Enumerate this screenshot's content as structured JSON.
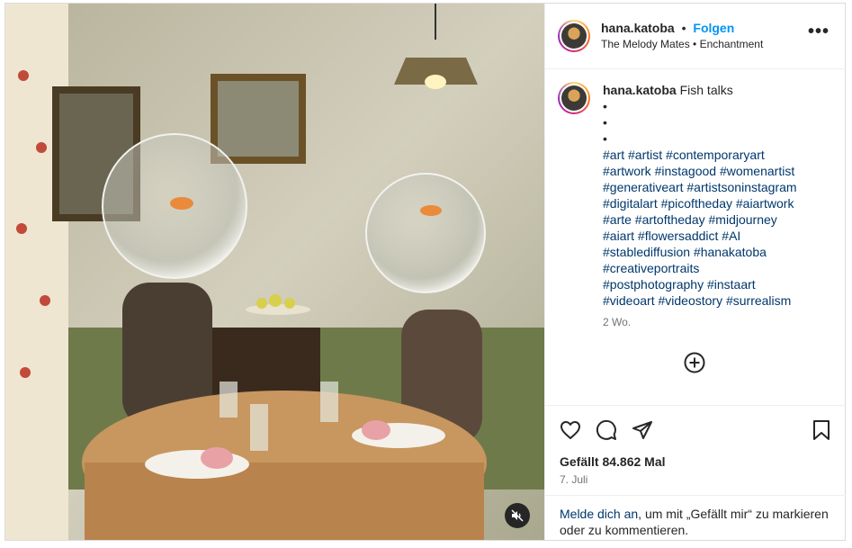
{
  "post": {
    "username": "hana.katoba",
    "follow_label": "Folgen",
    "separator": "•",
    "audio": "The Melody Mates • Enchantment",
    "more_label": "•••"
  },
  "caption": {
    "username": "hana.katoba",
    "title": "Fish talks",
    "dots": "•\n•\n•",
    "hashtags": "#art #artist #contemporaryart\n#artwork #instagood #womenartist\n#generativeart  #artistsoninstagram\n#digitalart #picoftheday #aiartwork\n#arte #artoftheday #midjourney\n#aiart #flowersaddict #AI\n#stablediffusion #hanakatoba\n#creativeportraits\n#postphotography #instaart\n#videoart #videostory #surrealism",
    "time_ago": "2 Wo."
  },
  "actions": {
    "icons": [
      "heart-icon",
      "comment-icon",
      "share-icon",
      "bookmark-icon"
    ],
    "likes": "Gefällt 84.862 Mal",
    "date": "7. Juli"
  },
  "login": {
    "link": "Melde dich an",
    "text": ", um mit „Gefällt mir“ zu markieren oder zu kommentieren."
  },
  "colors": {
    "link": "#0095f6",
    "hashtag": "#00376b",
    "muted": "#737373"
  }
}
